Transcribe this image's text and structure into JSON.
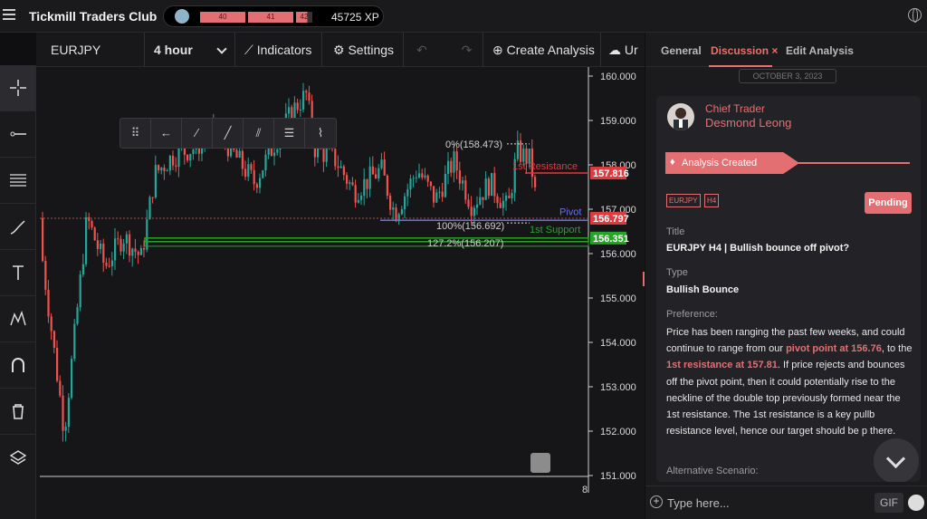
{
  "app": {
    "title": "Tickmill Traders Club"
  },
  "xp": {
    "levels": [
      "40",
      "41",
      "42"
    ],
    "value": "45725 XP"
  },
  "toolbar": {
    "symbol": "EURJPY",
    "interval": "4 hour",
    "indicators": "Indicators",
    "settings": "Settings",
    "create_analysis": "Create Analysis",
    "upload": "Ur"
  },
  "chart": {
    "y_ticks": [
      "160.000",
      "159.000",
      "158.000",
      "157.000",
      "156.000",
      "155.000",
      "154.000",
      "153.000",
      "152.000",
      "151.000"
    ],
    "x_tick": "8",
    "price_tags": [
      {
        "label": "157.816",
        "bg": "#e0393e"
      },
      {
        "label": "156.797",
        "bg": "#e0393e"
      },
      {
        "label": "156.351",
        "bg": "#25a525"
      }
    ],
    "annotations": {
      "fib0": "0%(158.473)",
      "fib100": "100%(156.692)",
      "fib127": "127.2%(156.207)",
      "resistance": "1st Resistance",
      "pivot": "Pivot",
      "support": "1st Support"
    },
    "colors": {
      "up": "#26a69a",
      "down": "#ef5350",
      "resistance": "#e0393e",
      "pivot": "#6b6fe0",
      "support": "#25a525"
    }
  },
  "panel": {
    "tabs": [
      "General",
      "Discussion",
      "Edit Analysis"
    ],
    "tab_close": "×",
    "date": "OCTOBER 3, 2023",
    "author_role": "Chief Trader",
    "author_name": "Desmond Leong",
    "badge": "Analysis Created",
    "tags": [
      "EURJPY",
      "H4"
    ],
    "status": "Pending",
    "title_label": "Title",
    "title_value": "EURJPY H4 | Bullish bounce off pivot?",
    "type_label": "Type",
    "type_value": "Bullish Bounce",
    "preference_label": "Preference:",
    "pref_1": "Price has been ranging the past few weeks, and could continue to range from our ",
    "pref_hl1": "pivot point at 156.76",
    "pref_2": ", to the ",
    "pref_hl2": "1st resistance at 157.81",
    "pref_3": ". If price rejects and bounces off the pivot point, then it could potentially rise to the neckline of the double top previously formed near the 1st resistance. The 1st resistance is a key pullb resistance level, hence our target should be p there.",
    "alt_label": "Alternative Scenario:",
    "input_placeholder": "Type here...",
    "gif": "GIF"
  }
}
